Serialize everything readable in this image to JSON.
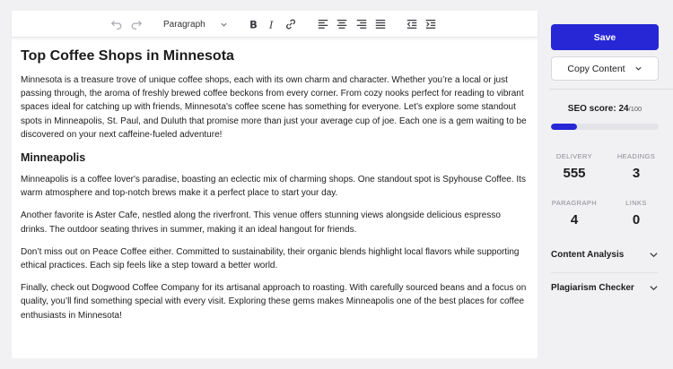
{
  "toolbar": {
    "format_value": "Paragraph",
    "buttons": [
      "undo-icon",
      "redo-icon",
      "bold-icon",
      "italic-icon",
      "link-icon",
      "align-left-icon",
      "align-center-icon",
      "align-right-icon",
      "align-justify-icon",
      "outdent-icon",
      "indent-icon"
    ]
  },
  "document": {
    "title": "Top Coffee Shops in Minnesota",
    "intro": "Minnesota is a treasure trove of unique coffee shops, each with its own charm and character. Whether you’re a local or just passing through, the aroma of freshly brewed coffee beckons from every corner. From cozy nooks perfect for reading to vibrant spaces ideal for catching up with friends, Minnesota's coffee scene has something for everyone. Let’s explore some standout spots in Minneapolis, St. Paul, and Duluth that promise more than just your average cup of joe. Each one is a gem waiting to be discovered on your next caffeine-fueled adventure!",
    "section_heading": "Minneapolis",
    "paragraphs": [
      "Minneapolis is a coffee lover's paradise, boasting an eclectic mix of charming shops. One standout spot is Spyhouse Coffee. Its warm atmosphere and top-notch brews make it a perfect place to start your day.",
      "Another favorite is Aster Cafe, nestled along the riverfront. This venue offers stunning views alongside delicious espresso drinks. The outdoor seating thrives in summer, making it an ideal hangout for friends.",
      "Don’t miss out on Peace Coffee either. Committed to sustainability, their organic blends highlight local flavors while supporting ethical practices. Each sip feels like a step toward a better world.",
      "Finally, check out Dogwood Coffee Company for its artisanal approach to roasting. With carefully sourced beans and a focus on quality, you’ll find something special with every visit. Exploring these gems makes Minneapolis one of the best places for coffee enthusiasts in Minnesota!"
    ]
  },
  "sidebar": {
    "save_label": "Save",
    "copy_label": "Copy Content",
    "seo_label": "SEO score:",
    "seo_score": "24",
    "seo_max": "/100",
    "seo_fraction": 0.24,
    "accent_color": "#2727d6",
    "stats": [
      {
        "label": "DELIVERY",
        "value": "555"
      },
      {
        "label": "HEADINGS",
        "value": "3"
      },
      {
        "label": "PARAGRAPH",
        "value": "4"
      },
      {
        "label": "LINKS",
        "value": "0"
      }
    ],
    "sections": [
      "Content Analysis",
      "Plagiarism Checker"
    ]
  }
}
